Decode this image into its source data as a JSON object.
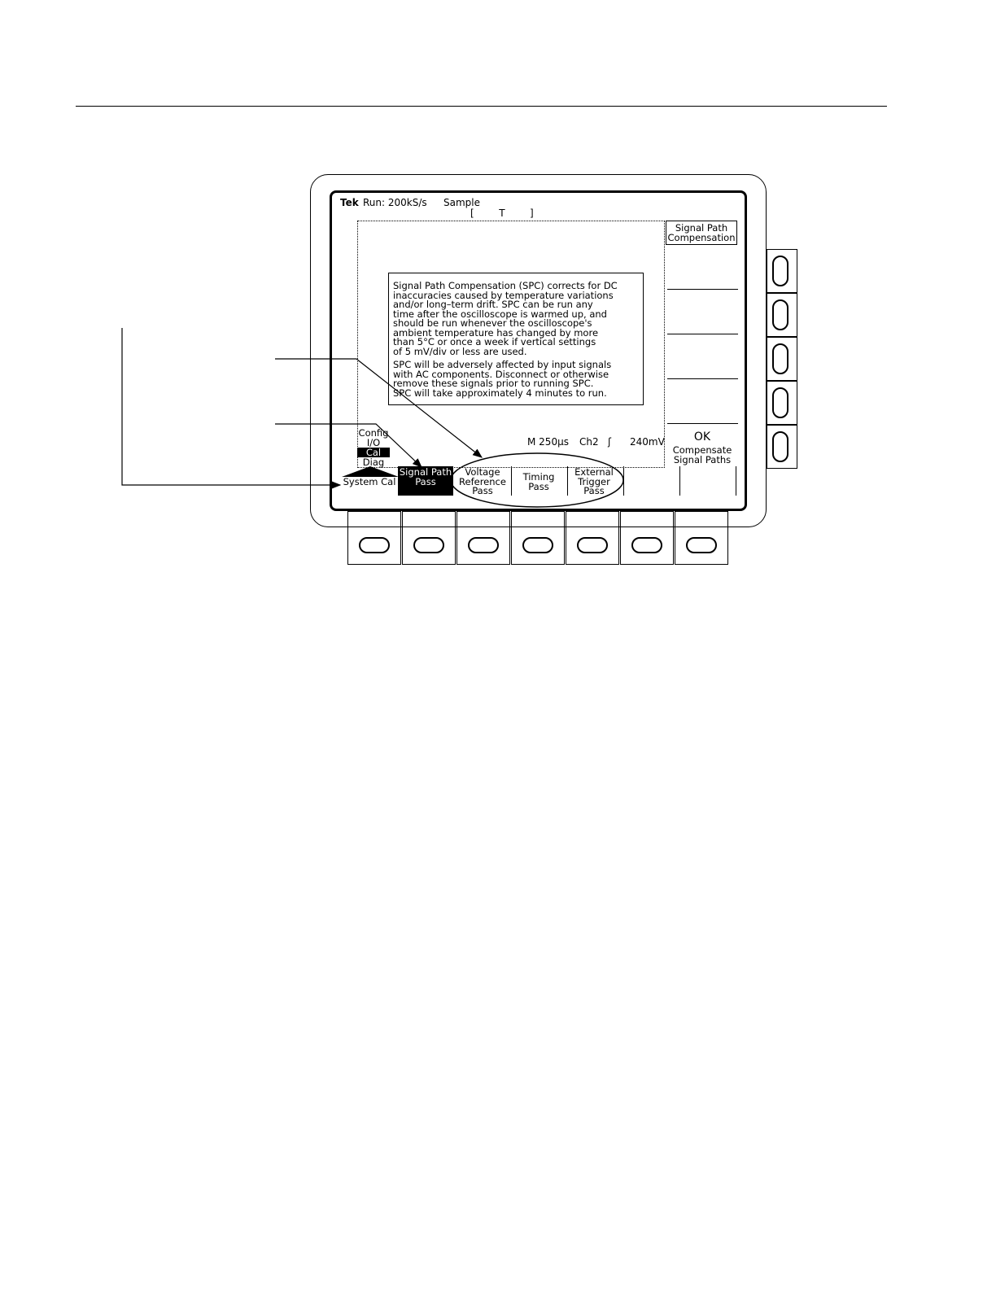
{
  "status_bar": {
    "brand": "Tek",
    "run_state": "Run: 200kS/s",
    "acquire_mode": "Sample",
    "trigger_bracket": "[        T        ]"
  },
  "readout": {
    "timebase": "M 250µs",
    "channel": "Ch2",
    "slope": "ʃ",
    "level": "240mV"
  },
  "dialog": {
    "paragraph1": "Signal Path Compensation (SPC) corrects for DC\ninaccuracies caused by temperature variations\nand/or long–term drift. SPC can be run any\ntime after the oscilloscope is warmed up, and\nshould be run whenever the oscilloscope's\nambient temperature has changed by more\nthan 5°C or once a week if vertical settings\nof 5 mV/div or less are used.",
    "paragraph2": "SPC will be adversely affected by input signals\nwith AC components. Disconnect or otherwise\nremove these signals prior to running SPC.\nSPC will take approximately 4 minutes to run."
  },
  "side_menu": {
    "title": "Signal Path Compensation",
    "ok_label": "OK",
    "ok_action": "Compensate Signal Paths"
  },
  "utility_menu": {
    "items": [
      "Config",
      "I/O",
      "Cal",
      "Diag"
    ],
    "selected": "Cal"
  },
  "bottom_menu": {
    "system_cal": "System Cal",
    "signal_path": "Signal Path Pass",
    "voltage_reference": "Voltage Reference Pass",
    "timing": "Timing Pass",
    "external_trigger": "External Trigger Pass"
  }
}
